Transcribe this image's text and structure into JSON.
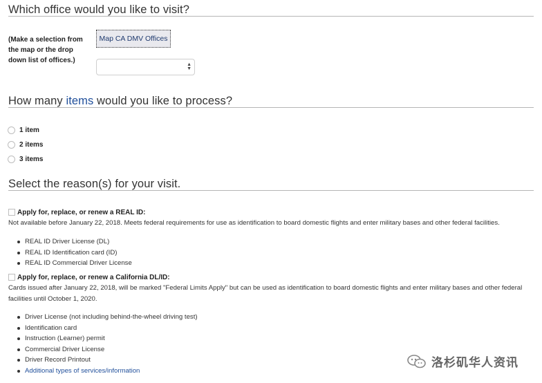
{
  "office_section": {
    "title": "Which office would you like to visit?",
    "instructions": "(Make a selection from the map or the drop down list of offices.)",
    "map_button_label": "Map CA DMV Offices",
    "office_select_value": ""
  },
  "items_section": {
    "title_before": "How many ",
    "title_link": "items",
    "title_after": " would you like to process?",
    "options": [
      "1 item",
      "2 items",
      "3 items"
    ]
  },
  "reasons_section": {
    "title": "Select the reason(s) for your visit.",
    "real_id": {
      "label": "Apply for, replace, or renew a REAL ID:",
      "description": "Not available before January 22, 2018. Meets federal requirements for use as identification to board domestic flights and enter military bases and other federal facilities.",
      "items": [
        "REAL ID Driver License (DL)",
        "REAL ID Identification card (ID)",
        "REAL ID Commercial Driver License"
      ]
    },
    "ca_dl": {
      "label": "Apply for, replace, or renew a California DL/ID:",
      "description": "Cards issued after January 22, 2018, will be marked \"Federal Limits Apply\" but can be used as identification to board domestic flights and enter military bases and other federal facilities until October 1, 2020.",
      "items": [
        "Driver License (not including behind-the-wheel driving test)",
        "Identification card",
        "Instruction (Learner) permit",
        "Commercial Driver License",
        "Driver Record Printout"
      ],
      "more_link": "Additional types of services/information"
    }
  },
  "watermark": {
    "text": "洛杉矶华人资讯",
    "icon": "wechat-icon"
  },
  "colors": {
    "link": "#1f4e9a",
    "rule": "#b5b5b5",
    "button_bg": "#e9e9ee"
  }
}
